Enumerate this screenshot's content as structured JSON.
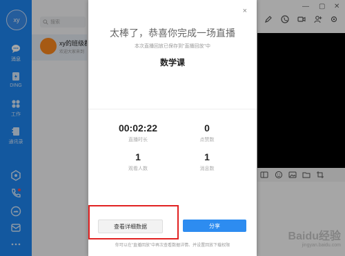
{
  "rail": {
    "avatar_text": "xy",
    "items": [
      {
        "label": "消息",
        "icon": "chat-icon"
      },
      {
        "label": "DING",
        "icon": "ding-icon"
      },
      {
        "label": "工作",
        "icon": "grid-icon"
      },
      {
        "label": "通讯录",
        "icon": "contacts-icon"
      }
    ],
    "bottom_icons": [
      "hexagon-icon",
      "phone-icon",
      "cloud-icon",
      "mail-icon",
      "more-icon"
    ]
  },
  "conversation_list": {
    "search_placeholder": "搜索",
    "items": [
      {
        "title": "xy的班级群",
        "preview": "欢迎大家来到"
      }
    ]
  },
  "modal": {
    "close_label": "×",
    "headline": "太棒了，恭喜你完成一场直播",
    "subtitle": "本次直播回放已保存到\"直播回放\"中",
    "course_name": "数学课",
    "stats": [
      {
        "value": "00:02:22",
        "label": "直播时长"
      },
      {
        "value": "0",
        "label": "点赞数"
      },
      {
        "value": "1",
        "label": "观看人数"
      },
      {
        "value": "1",
        "label": "消息数"
      }
    ],
    "detail_button": "查看详细数据",
    "share_button": "分享",
    "footnote": "你可以在\"直播回放\"中再次查看数据详情、并设置回放下载权限"
  },
  "watermark": {
    "main": "Baidu经验",
    "url": "jingyan.baidu.com"
  },
  "colors": {
    "rail": "#1e88f5",
    "primary_button": "#2d8cf0",
    "highlight": "#e12020"
  }
}
